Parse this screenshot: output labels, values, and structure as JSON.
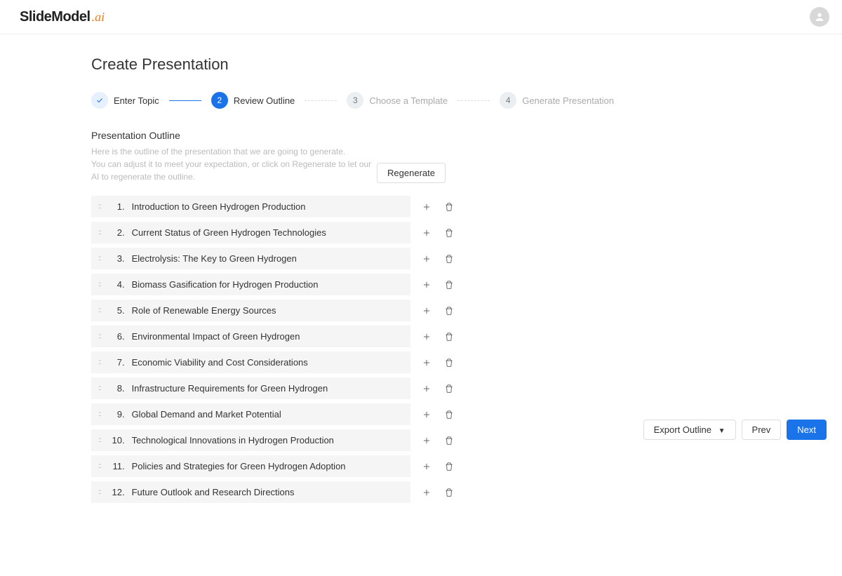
{
  "logo": {
    "main": "SlideModel",
    "suffix": ".ai"
  },
  "page_title": "Create Presentation",
  "steps": [
    {
      "label": "Enter Topic"
    },
    {
      "num": "2",
      "label": "Review Outline"
    },
    {
      "num": "3",
      "label": "Choose a Template"
    },
    {
      "num": "4",
      "label": "Generate Presentation"
    }
  ],
  "outline": {
    "title": "Presentation Outline",
    "desc": "Here is the outline of the presentation that we are going to generate.\nYou can adjust it to meet your expectation, or click on Regenerate to let our AI to regenerate the outline.",
    "regenerate": "Regenerate",
    "items": [
      {
        "n": "1.",
        "text": "Introduction to Green Hydrogen Production"
      },
      {
        "n": "2.",
        "text": "Current Status of Green Hydrogen Technologies"
      },
      {
        "n": "3.",
        "text": "Electrolysis: The Key to Green Hydrogen"
      },
      {
        "n": "4.",
        "text": "Biomass Gasification for Hydrogen Production"
      },
      {
        "n": "5.",
        "text": "Role of Renewable Energy Sources"
      },
      {
        "n": "6.",
        "text": "Environmental Impact of Green Hydrogen"
      },
      {
        "n": "7.",
        "text": "Economic Viability and Cost Considerations"
      },
      {
        "n": "8.",
        "text": "Infrastructure Requirements for Green Hydrogen"
      },
      {
        "n": "9.",
        "text": "Global Demand and Market Potential"
      },
      {
        "n": "10.",
        "text": "Technological Innovations in Hydrogen Production"
      },
      {
        "n": "11.",
        "text": "Policies and Strategies for Green Hydrogen Adoption"
      },
      {
        "n": "12.",
        "text": "Future Outlook and Research Directions"
      }
    ]
  },
  "footer": {
    "export": "Export Outline",
    "prev": "Prev",
    "next": "Next"
  }
}
